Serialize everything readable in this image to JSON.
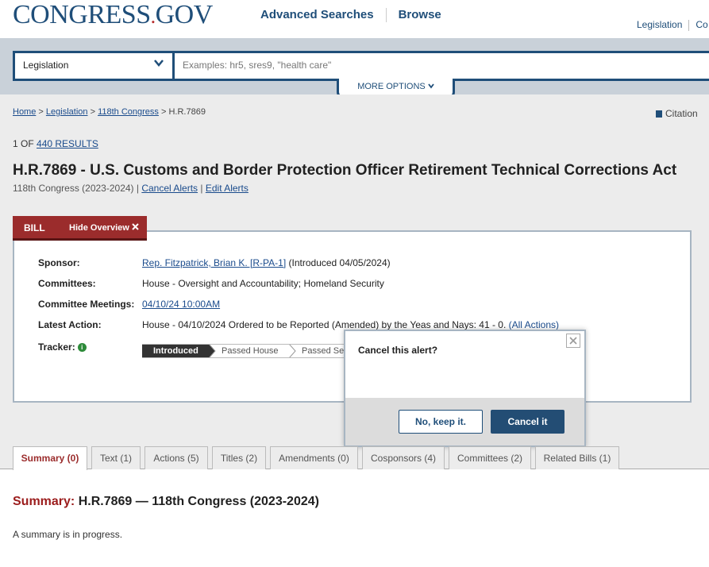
{
  "header": {
    "logo_main": "CONGRESS",
    "logo_dot": ".",
    "logo_tld": "GOV",
    "nav": [
      "Advanced Searches",
      "Browse"
    ],
    "right_links": [
      "Legislation",
      "Co"
    ]
  },
  "search": {
    "scope_value": "Legislation",
    "placeholder": "Examples: hr5, sres9, \"health care\"",
    "more_options": "MORE OPTIONS"
  },
  "breadcrumb": {
    "home": "Home",
    "legislation": "Legislation",
    "congress": "118th Congress",
    "current": "H.R.7869",
    "sep": ">"
  },
  "citation": "Citation",
  "results": {
    "prefix": "1 OF",
    "link": "440 RESULTS"
  },
  "bill": {
    "title": "H.R.7869 - U.S. Customs and Border Protection Officer Retirement Technical Corrections Act",
    "congress": "118th Congress (2023-2024)",
    "cancel_alerts": "Cancel Alerts",
    "edit_alerts": "Edit Alerts",
    "tab_label": "BILL",
    "hide_overview": "Hide Overview"
  },
  "overview": {
    "sponsor_label": "Sponsor:",
    "sponsor_link": "Rep. Fitzpatrick, Brian K. [R-PA-1]",
    "sponsor_note": "(Introduced 04/05/2024)",
    "committees_label": "Committees:",
    "committees_value": "House - Oversight and Accountability; Homeland Security",
    "meetings_label": "Committee Meetings:",
    "meetings_link": "04/10/24 10:00AM",
    "latest_label": "Latest Action:",
    "latest_value": "House - 04/10/2024 Ordered to be Reported (Amended) by the Yeas and Nays: 41 - 0.",
    "all_actions": "(All Actions)",
    "tracker_label": "Tracker:",
    "tracker_steps": [
      "Introduced",
      "Passed House",
      "Passed Se"
    ]
  },
  "dialog": {
    "question": "Cancel this alert?",
    "keep_label": "No, keep it.",
    "cancel_label": "Cancel it"
  },
  "tabs": [
    "Summary (0)",
    "Text (1)",
    "Actions (5)",
    "Titles (2)",
    "Amendments (0)",
    "Cosponsors (4)",
    "Committees (2)",
    "Related Bills (1)"
  ],
  "summary": {
    "label": "Summary:",
    "heading": "H.R.7869 — 118th Congress (2023-2024)",
    "text": "A summary is in progress."
  },
  "colors": {
    "brand_blue": "#1f4e79",
    "bill_red": "#9b2c2c",
    "button_dark": "#234d74"
  }
}
